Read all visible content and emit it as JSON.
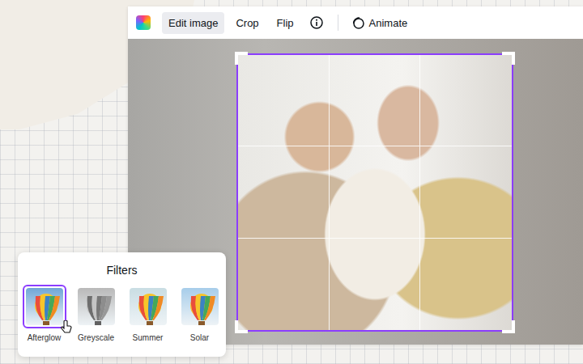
{
  "toolbar": {
    "items": [
      {
        "label": "Edit image",
        "selected": true
      },
      {
        "label": "Crop",
        "selected": false
      },
      {
        "label": "Flip",
        "selected": false
      }
    ],
    "animate": "Animate"
  },
  "filters": {
    "title": "Filters",
    "items": [
      {
        "label": "Afterglow",
        "selected": true,
        "kind": "color",
        "color": "#6fa6d6"
      },
      {
        "label": "Greyscale",
        "selected": false,
        "kind": "greyscale",
        "color": "#b9b9b9"
      },
      {
        "label": "Summer",
        "selected": false,
        "kind": "color",
        "color": "#c9dde3"
      },
      {
        "label": "Solar",
        "selected": false,
        "kind": "color",
        "color": "#a7cdea"
      }
    ]
  }
}
